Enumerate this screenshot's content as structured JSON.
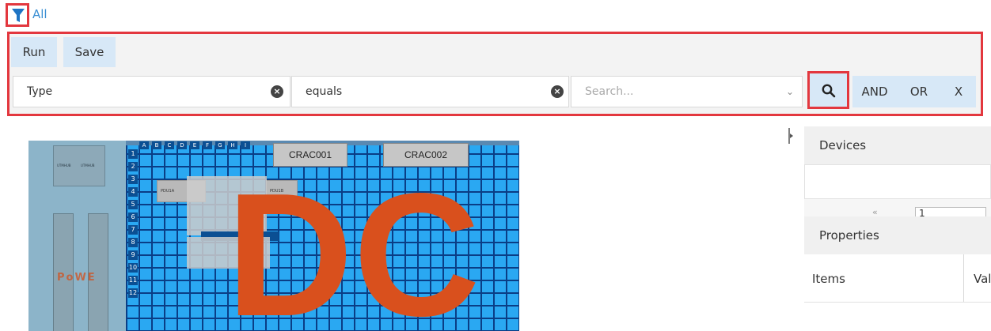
{
  "filter": {
    "icon": "filter-icon",
    "all_label": "All"
  },
  "toolbar": {
    "run_label": "Run",
    "save_label": "Save"
  },
  "query": {
    "field_value": "Type",
    "operator_value": "equals",
    "search_placeholder": "Search...",
    "and_label": "AND",
    "or_label": "OR",
    "x_label": "X"
  },
  "floorplan": {
    "crac1": "CRAC001",
    "crac2": "CRAC002",
    "pdu1": "PDU1A",
    "pdu2": "PDU1B",
    "power_text": "PoWE",
    "ups_labels": [
      "UTMHUB",
      "UTMHUB"
    ],
    "dc_text": "DC",
    "row_numbers": [
      "1",
      "2",
      "3",
      "4",
      "5",
      "6",
      "7",
      "8",
      "9",
      "10",
      "11",
      "12"
    ],
    "col_letters": [
      "A",
      "B",
      "C",
      "D",
      "E",
      "F",
      "G",
      "H",
      "I"
    ],
    "grid_color": "#2aa8f2",
    "line_color": "#0a3e86",
    "dc_color": "#d9501d"
  },
  "panel": {
    "devices_title": "Devices",
    "pager_value": "1",
    "pager_prev": "«",
    "properties_title": "Properties",
    "items_col": "Items",
    "value_col": "Val"
  },
  "colors": {
    "accent": "#3a8fd3",
    "highlight": "#e3373e",
    "button_bg": "#d7e8f7"
  }
}
